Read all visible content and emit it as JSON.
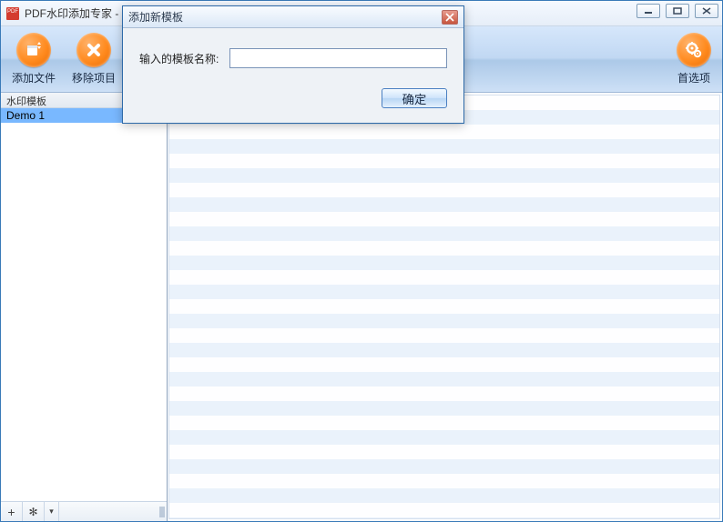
{
  "titlebar": {
    "title": "PDF水印添加专家 -"
  },
  "toolbar": {
    "add_file_label": "添加文件",
    "remove_item_label": "移除项目",
    "preferences_label": "首选项"
  },
  "sidebar": {
    "header": "水印模板",
    "items": [
      "Demo 1"
    ],
    "footer": {
      "add": "+",
      "settings": "✻",
      "dropdown": "▾"
    }
  },
  "modal": {
    "title": "添加新模板",
    "label": "输入的模板名称:",
    "value": "",
    "ok": "确定"
  }
}
